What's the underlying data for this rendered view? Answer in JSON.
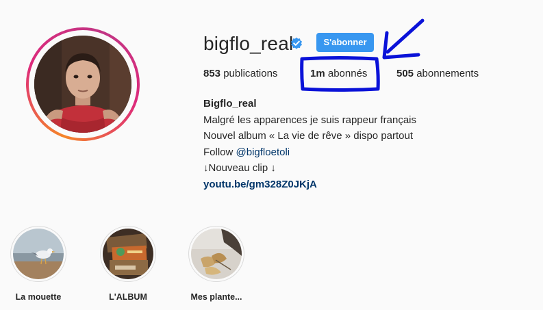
{
  "profile": {
    "username": "bigflo_real",
    "follow_label": "S'abonner",
    "stats": {
      "posts_count": "853",
      "posts_label": "publications",
      "followers_count": "1m",
      "followers_label": "abonnés",
      "following_count": "505",
      "following_label": "abonnements"
    },
    "bio": {
      "name": "Bigflo_real",
      "line1": "Malgré les apparences je suis rappeur français",
      "line2": "Nouvel album « La vie de rêve » dispo partout",
      "line3_prefix": "Follow ",
      "line3_mention": "@bigfloetoli",
      "line4": "↓Nouveau clip ↓",
      "link": "youtu.be/gm328Z0JKjA"
    }
  },
  "highlights": [
    {
      "label": "La mouette",
      "icon": "seagull-photo"
    },
    {
      "label": "L'ALBUM",
      "icon": "album-photo"
    },
    {
      "label": "Mes plante...",
      "icon": "plant-photo"
    }
  ],
  "colors": {
    "accent": "#3897f0",
    "annotation": "#0a12d8",
    "link": "#003569",
    "verified": "#3897f0"
  }
}
